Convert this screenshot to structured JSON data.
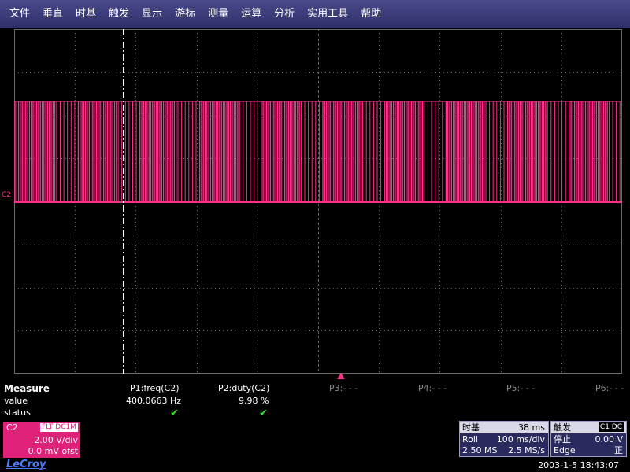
{
  "menu": [
    "文件",
    "垂直",
    "时基",
    "触发",
    "显示",
    "游标",
    "测量",
    "运算",
    "分析",
    "实用工具",
    "帮助"
  ],
  "display": {
    "channel_marker": "C2",
    "trace_color": "#ff2f8a",
    "grid_color": "#6a6a6a"
  },
  "measure": {
    "title": "Measure",
    "row_labels": [
      "value",
      "status"
    ],
    "params": [
      {
        "name": "P1:freq(C2)",
        "value": "400.0663 Hz",
        "status": "✔"
      },
      {
        "name": "P2:duty(C2)",
        "value": "9.98 %",
        "status": "✔"
      },
      {
        "name": "P3:- - -",
        "value": "",
        "status": ""
      },
      {
        "name": "P4:- - -",
        "value": "",
        "status": ""
      },
      {
        "name": "P5:- - -",
        "value": "",
        "status": ""
      },
      {
        "name": "P6:- - -",
        "value": "",
        "status": ""
      }
    ]
  },
  "channel": {
    "name": "C2",
    "coupling": "FLT DC1M",
    "vdiv": "2.00 V/div",
    "offset": "0.0 mV ofst",
    "color": "#e0217a"
  },
  "timebase": {
    "title": "时基",
    "delay": "38 ms",
    "mode": "Roll",
    "tdiv": "100 ms/div",
    "samples": "2.50 MS",
    "rate": "2.5 MS/s"
  },
  "trigger": {
    "title": "触发",
    "source": "C1 DC",
    "state": "停止",
    "level": "0.00 V",
    "type": "Edge",
    "slope": "正"
  },
  "footer": {
    "logo": "LeCroy",
    "datetime": "2003-1-5 18:43:07"
  }
}
